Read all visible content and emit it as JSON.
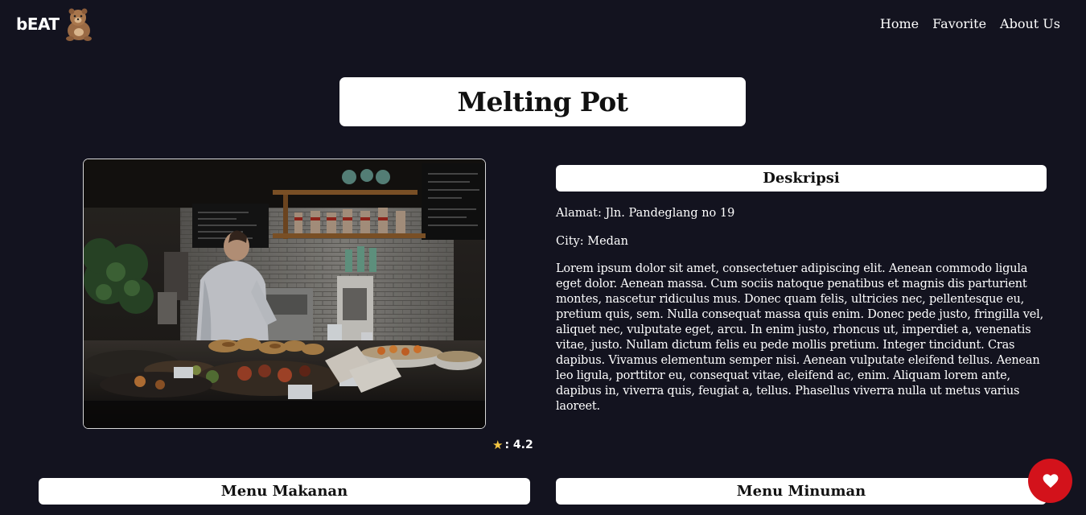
{
  "nav": {
    "brand": "bEAT",
    "logo_icon": "bear-mascot-icon",
    "links": [
      "Home",
      "Favorite",
      "About Us"
    ]
  },
  "restaurant": {
    "name": "Melting Pot",
    "rating_icon": "star-icon",
    "rating_text": ": 4.2",
    "rating_value": 4.2
  },
  "description": {
    "heading": "Deskripsi",
    "address": "Alamat: Jln. Pandeglang no 19",
    "city": "City: Medan",
    "text": "Lorem ipsum dolor sit amet, consectetuer adipiscing elit. Aenean commodo ligula eget dolor. Aenean massa. Cum sociis natoque penatibus et magnis dis parturient montes, nascetur ridiculus mus. Donec quam felis, ultricies nec, pellentesque eu, pretium quis, sem. Nulla consequat massa quis enim. Donec pede justo, fringilla vel, aliquet nec, vulputate eget, arcu. In enim justo, rhoncus ut, imperdiet a, venenatis vitae, justo. Nullam dictum felis eu pede mollis pretium. Integer tincidunt. Cras dapibus. Vivamus elementum semper nisi. Aenean vulputate eleifend tellus. Aenean leo ligula, porttitor eu, consequat vitae, eleifend ac, enim. Aliquam lorem ante, dapibus in, viverra quis, feugiat a, tellus. Phasellus viverra nulla ut metus varius laoreet."
  },
  "menus": {
    "food_heading": "Menu Makanan",
    "drink_heading": "Menu Minuman"
  },
  "favorite_button": {
    "icon": "heart-icon",
    "color": "#d3121b"
  },
  "colors": {
    "background": "#13131f",
    "panel": "#ffffff",
    "star": "#f4c542"
  }
}
